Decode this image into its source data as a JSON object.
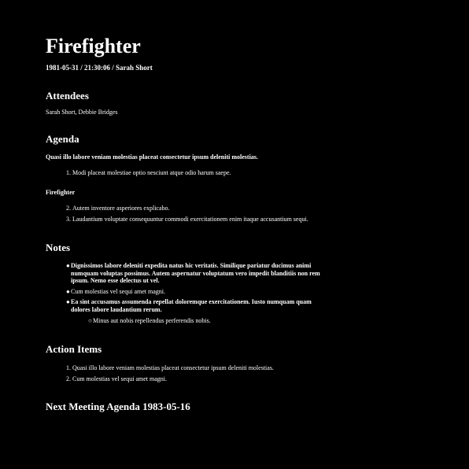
{
  "document": {
    "title": "Firefighter",
    "meta": "1981-05-31 / 21:30:06 / Sarah Short",
    "attendees": {
      "heading": "Attendees",
      "text": "Sarah Short, Debbie Bridges"
    },
    "agenda": {
      "heading": "Agenda",
      "intro": "Quasi illo labore veniam molestias placeat consectetur ipsum deleniti molestias.",
      "items_a": [
        {
          "num": "1.",
          "text": "Modi placeat molestiae optio nesciunt atque odio harum saepe."
        }
      ],
      "subheading": "Firefighter",
      "items_b": [
        {
          "num": "2.",
          "text": "Autem inventore asperiores explicabo."
        },
        {
          "num": "3.",
          "text": "Laudantium voluptate consequuntur commodi exercitationem enim itaque accusantium sequi."
        }
      ]
    },
    "notes": {
      "heading": "Notes",
      "bullet": "●",
      "sub_bullet": "○",
      "items": [
        "Dignissimos labore deleniti expedita natus hic veritatis. Similique pariatur ducimus animi numquam voluptas possimus. Autem aspernatur voluptatum vero impedit blanditiis non rem ipsum. Nemo esse delectus ut vel.",
        "Cum molestias vel sequi amet magni.",
        "Ea sint accusamus assumenda repellat doloremque exercitationem. Iusto numquam quam dolores labore laudantium rerum."
      ],
      "sub_items": [
        "Minus aut nobis repellendus perferendis nobis."
      ]
    },
    "action_items": {
      "heading": "Action Items",
      "items": [
        {
          "num": "1.",
          "text": "Quasi illo labore veniam molestias placeat consectetur ipsum deleniti molestias."
        },
        {
          "num": "2.",
          "text": "Cum molestias vel sequi amet magni."
        }
      ]
    },
    "next_meeting": {
      "heading": "Next Meeting Agenda 1983-05-16"
    }
  },
  "colors": {
    "background": "#000000",
    "text": "#ffffff"
  }
}
